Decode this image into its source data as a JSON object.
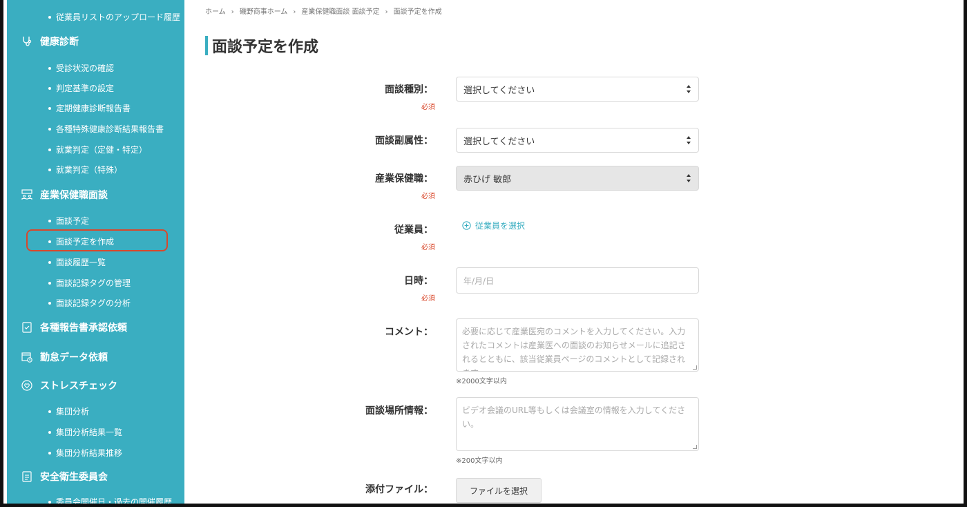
{
  "sidebar": {
    "items": [
      {
        "type": "sub",
        "label": "従業員リストのアップロード履歴"
      },
      {
        "type": "section",
        "label": "健康診断",
        "icon": "stethoscope-icon"
      },
      {
        "type": "sub",
        "label": "受診状況の確認"
      },
      {
        "type": "sub",
        "label": "判定基準の設定"
      },
      {
        "type": "sub",
        "label": "定期健康診断報告書"
      },
      {
        "type": "sub",
        "label": "各種特殊健康診断結果報告書"
      },
      {
        "type": "sub",
        "label": "就業判定（定健・特定）"
      },
      {
        "type": "sub",
        "label": "就業判定（特殊）"
      },
      {
        "type": "section",
        "label": "産業保健職面談",
        "icon": "meeting-icon"
      },
      {
        "type": "sub",
        "label": "面談予定"
      },
      {
        "type": "sub",
        "label": "面談予定を作成"
      },
      {
        "type": "sub",
        "label": "面談履歴一覧"
      },
      {
        "type": "sub",
        "label": "面談記録タグの管理"
      },
      {
        "type": "sub",
        "label": "面談記録タグの分析"
      },
      {
        "type": "section",
        "label": "各種報告書承認依頼",
        "icon": "document-check-icon"
      },
      {
        "type": "section",
        "label": "勤怠データ依頼",
        "icon": "calendar-clock-icon"
      },
      {
        "type": "section",
        "label": "ストレスチェック",
        "icon": "heart-icon"
      },
      {
        "type": "sub",
        "label": "集団分析"
      },
      {
        "type": "sub",
        "label": "集団分析結果一覧"
      },
      {
        "type": "sub",
        "label": "集団分析結果推移"
      },
      {
        "type": "section",
        "label": "安全衛生委員会",
        "icon": "document-icon"
      },
      {
        "type": "sub",
        "label": "委員会開催日・過去の開催履歴"
      }
    ]
  },
  "breadcrumb": [
    "ホーム",
    "磯野商事ホーム",
    "産業保健職面談 面談予定",
    "面談予定を作成"
  ],
  "page_title": "面談予定を作成",
  "form": {
    "required_label": "必須",
    "interview_type": {
      "label": "面談種別：",
      "value": "選択してください"
    },
    "interview_sub": {
      "label": "面談副属性：",
      "value": "選択してください"
    },
    "staff": {
      "label": "産業保健職：",
      "value": "赤ひげ 敏郎"
    },
    "employee": {
      "label": "従業員：",
      "link": "従業員を選択"
    },
    "datetime": {
      "label": "日時：",
      "placeholder": "年/月/日"
    },
    "comment": {
      "label": "コメント：",
      "placeholder": "必要に応じて産業医宛のコメントを入力してください。入力されたコメントは産業医への面談のお知らせメールに追記されるとともに、該当従業員ページのコメントとして記録されます。",
      "note": "※2000文字以内"
    },
    "place": {
      "label": "面談場所情報：",
      "placeholder": "ビデオ会議のURL等もしくは会議室の情報を入力してください。",
      "note": "※200文字以内"
    },
    "attachment": {
      "label": "添付ファイル：",
      "button": "ファイルを選択"
    }
  },
  "colors": {
    "accent": "#3aaec1",
    "required": "#d9482b",
    "highlight": "#d9482b"
  }
}
